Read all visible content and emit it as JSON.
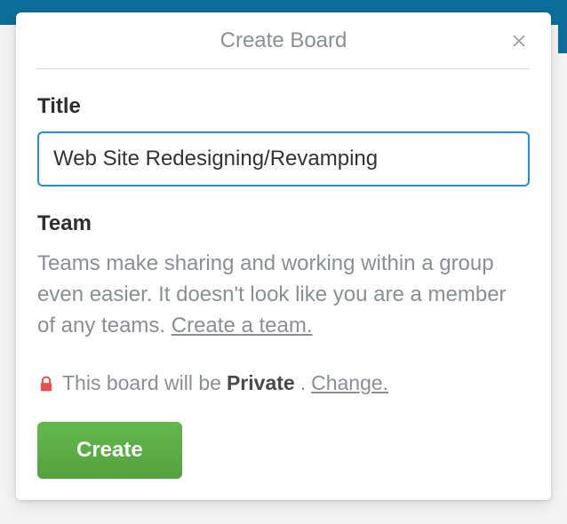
{
  "popover": {
    "title": "Create Board"
  },
  "title": {
    "label": "Title",
    "value": "Web Site Redesigning/Revamping"
  },
  "team": {
    "label": "Team",
    "description_part1": "Teams make sharing and working within a group even easier. It doesn't look like you are a member of any teams. ",
    "create_link": "Create a team."
  },
  "visibility": {
    "prefix": "This board will be ",
    "level": "Private",
    "suffix": ". ",
    "change_label": "Change."
  },
  "actions": {
    "create": "Create"
  }
}
